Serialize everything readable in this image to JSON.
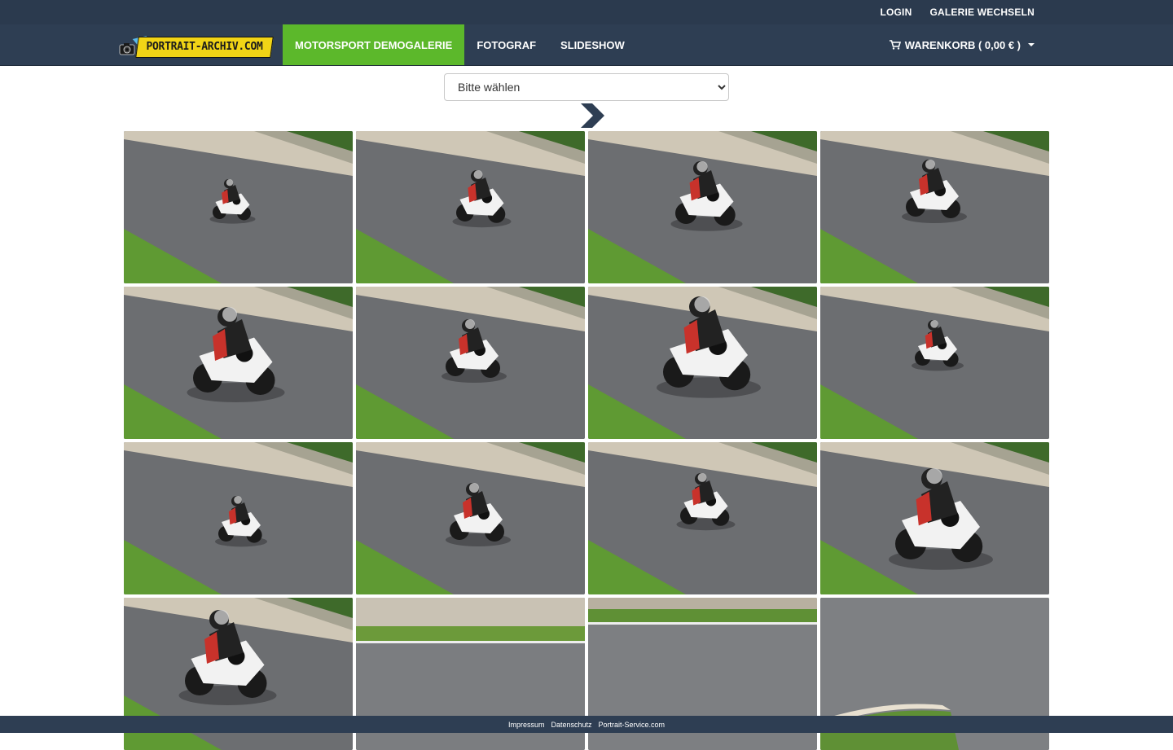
{
  "topbar": {
    "login": "LOGIN",
    "switch_gallery": "GALERIE WECHSELN"
  },
  "brand": {
    "logo_text": "PORTRAIT-ARCHIV.COM"
  },
  "nav": {
    "items": [
      {
        "label": "MOTORSPORT DEMOGALERIE",
        "active": true
      },
      {
        "label": "FOTOGRAF",
        "active": false
      },
      {
        "label": "SLIDESHOW",
        "active": false
      }
    ]
  },
  "cart": {
    "label": "WARENKORB ( 0,00 € )",
    "icon": "cart-icon"
  },
  "filter": {
    "selected": "Bitte wählen"
  },
  "next": {
    "icon": "chevron-right-icon"
  },
  "gallery": {
    "photos": [
      {
        "row": 1,
        "col": 1,
        "subject": "motorcycle"
      },
      {
        "row": 1,
        "col": 2,
        "subject": "motorcycle"
      },
      {
        "row": 1,
        "col": 3,
        "subject": "motorcycle"
      },
      {
        "row": 1,
        "col": 4,
        "subject": "motorcycle"
      },
      {
        "row": 2,
        "col": 1,
        "subject": "motorcycle"
      },
      {
        "row": 2,
        "col": 2,
        "subject": "motorcycle"
      },
      {
        "row": 2,
        "col": 3,
        "subject": "motorcycle"
      },
      {
        "row": 2,
        "col": 4,
        "subject": "motorcycle"
      },
      {
        "row": 3,
        "col": 1,
        "subject": "motorcycle"
      },
      {
        "row": 3,
        "col": 2,
        "subject": "motorcycle"
      },
      {
        "row": 3,
        "col": 3,
        "subject": "motorcycle"
      },
      {
        "row": 3,
        "col": 4,
        "subject": "motorcycle"
      },
      {
        "row": 4,
        "col": 1,
        "subject": "motorcycle"
      },
      {
        "row": 4,
        "col": 2,
        "subject": "empty-track"
      },
      {
        "row": 4,
        "col": 3,
        "subject": "empty-track"
      },
      {
        "row": 4,
        "col": 4,
        "subject": "empty-track"
      }
    ]
  },
  "footer": {
    "links": [
      "Impressum",
      "Datenschutz",
      "Portrait-Service.com"
    ]
  },
  "colors": {
    "topbar": "#2b3a4e",
    "navbar": "#2e3e53",
    "active_nav": "#5cb82b",
    "logo_yellow": "#f1d416"
  }
}
